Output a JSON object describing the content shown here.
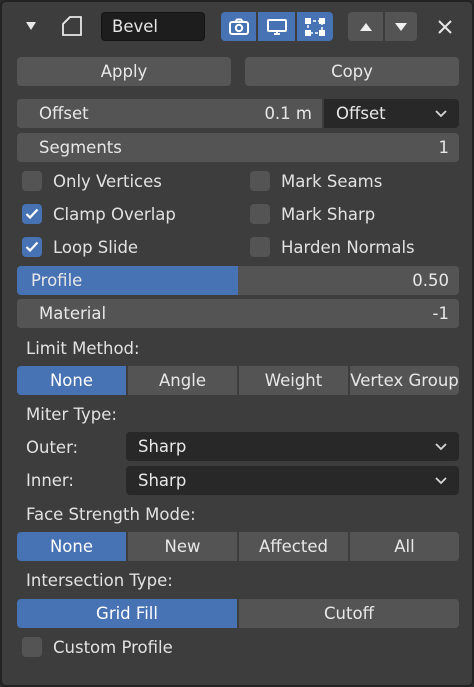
{
  "header": {
    "name_value": "Bevel"
  },
  "actions": {
    "apply_label": "Apply",
    "copy_label": "Copy"
  },
  "offset": {
    "label": "Offset",
    "value": "0.1 m",
    "type_value": "Offset"
  },
  "segments": {
    "label": "Segments",
    "value": "1"
  },
  "checkboxes": [
    {
      "label": "Only Vertices",
      "checked": false
    },
    {
      "label": "Mark Seams",
      "checked": false
    },
    {
      "label": "Clamp Overlap",
      "checked": true
    },
    {
      "label": "Mark Sharp",
      "checked": false
    },
    {
      "label": "Loop Slide",
      "checked": true
    },
    {
      "label": "Harden Normals",
      "checked": false
    }
  ],
  "profile": {
    "label": "Profile",
    "value": "0.50",
    "fraction": 0.5
  },
  "material": {
    "label": "Material",
    "value": "-1"
  },
  "limit_method": {
    "label": "Limit Method:",
    "options": [
      "None",
      "Angle",
      "Weight",
      "Vertex Group"
    ],
    "selected": 0
  },
  "miter_type": {
    "label": "Miter Type:",
    "outer_label": "Outer:",
    "outer_value": "Sharp",
    "inner_label": "Inner:",
    "inner_value": "Sharp"
  },
  "face_strength": {
    "label": "Face Strength Mode:",
    "options": [
      "None",
      "New",
      "Affected",
      "All"
    ],
    "selected": 0
  },
  "intersection": {
    "label": "Intersection Type:",
    "options": [
      "Grid Fill",
      "Cutoff"
    ],
    "selected": 0
  },
  "custom_profile": {
    "label": "Custom Profile",
    "checked": false
  },
  "colors": {
    "accent": "#4772b3",
    "panel": "#3d3d3d",
    "widget": "#545454"
  }
}
